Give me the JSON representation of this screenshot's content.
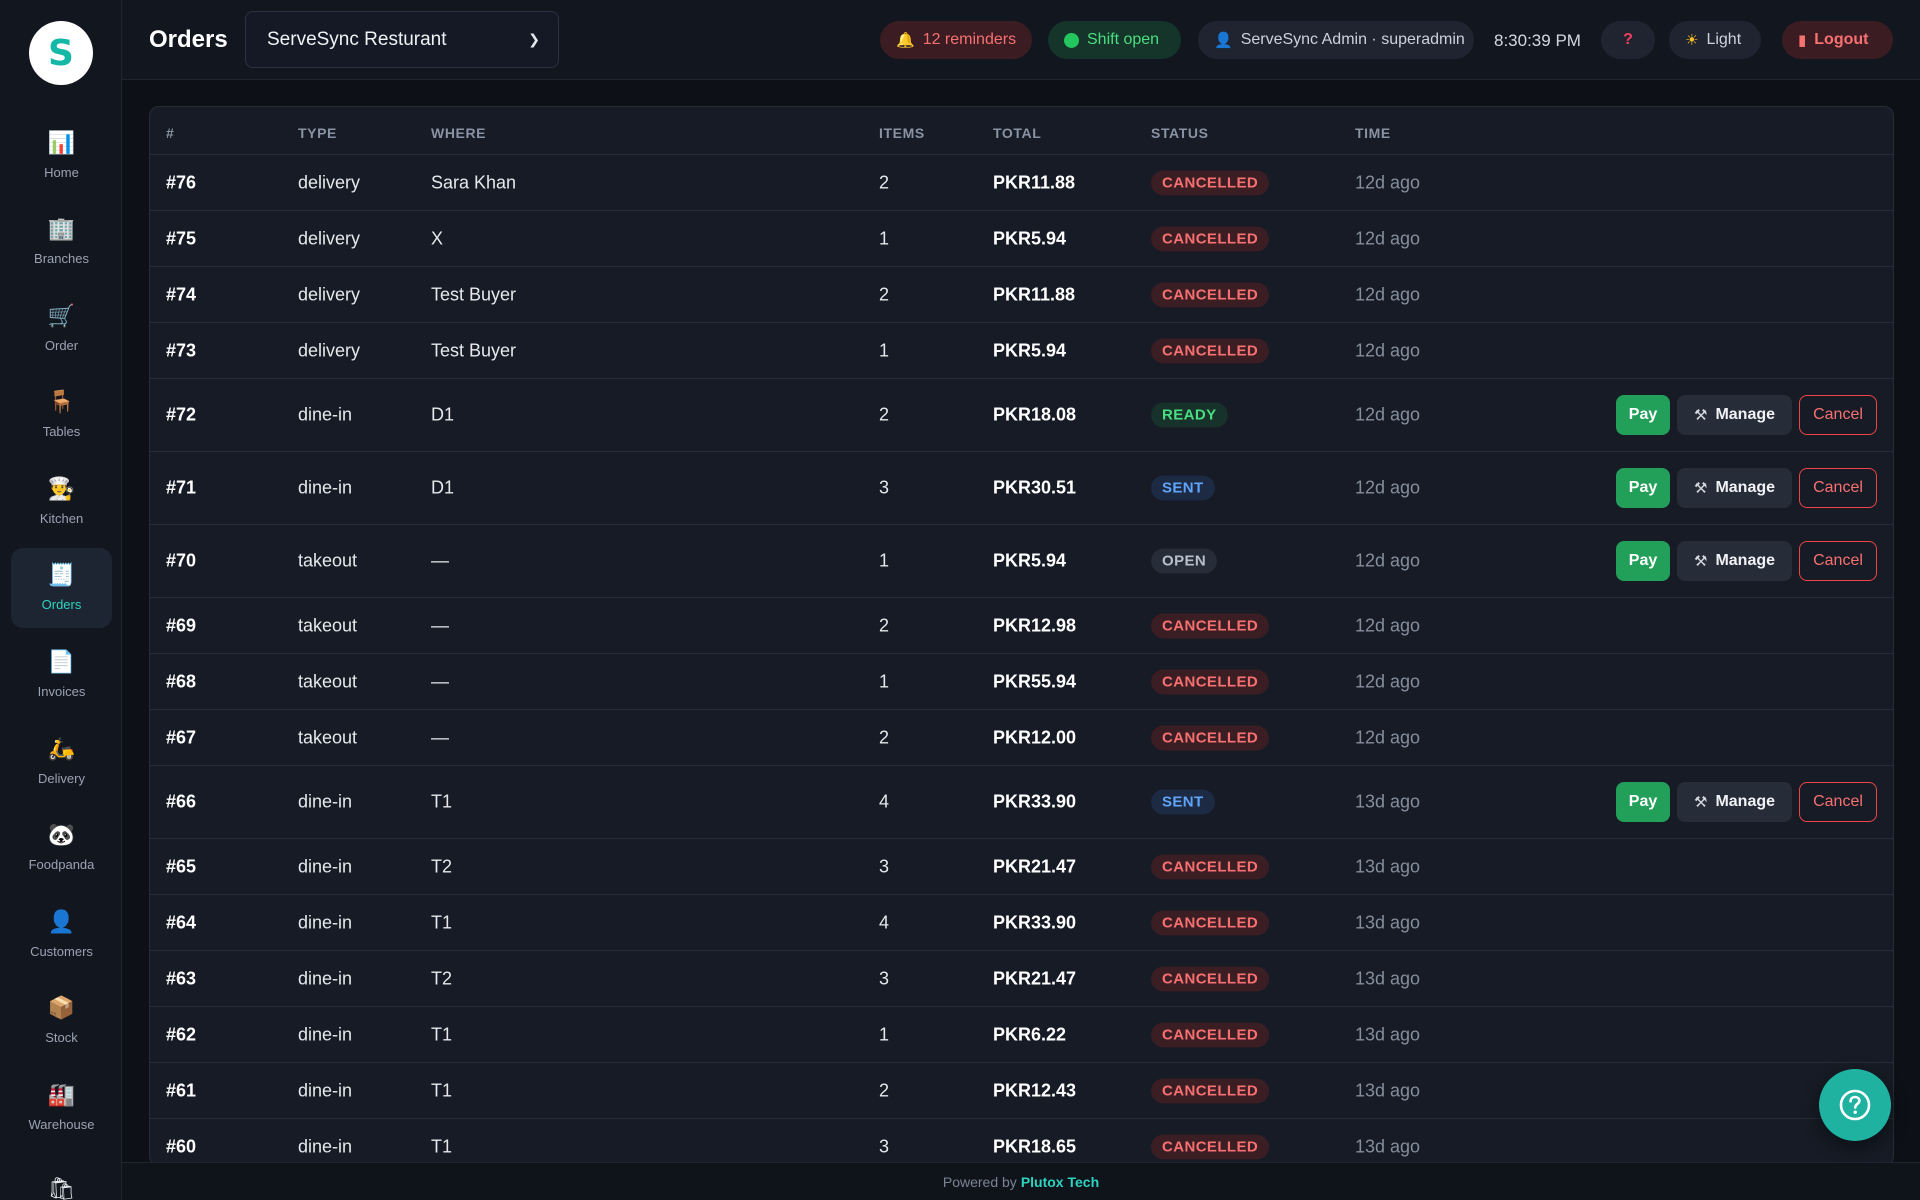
{
  "sidebar": {
    "logo_letter": "S",
    "items": [
      {
        "label": "Home",
        "icon": "chart-icon",
        "glyph": "📊",
        "active": false
      },
      {
        "label": "Branches",
        "icon": "building-icon",
        "glyph": "🏢",
        "active": false
      },
      {
        "label": "Order",
        "icon": "cart-icon",
        "glyph": "🛒",
        "active": false
      },
      {
        "label": "Tables",
        "icon": "chair-icon",
        "glyph": "🪑",
        "active": false
      },
      {
        "label": "Kitchen",
        "icon": "chef-icon",
        "glyph": "👨‍🍳",
        "active": false
      },
      {
        "label": "Orders",
        "icon": "receipt-icon",
        "glyph": "🧾",
        "active": true
      },
      {
        "label": "Invoices",
        "icon": "document-icon",
        "glyph": "📄",
        "active": false
      },
      {
        "label": "Delivery",
        "icon": "scooter-icon",
        "glyph": "🛵",
        "active": false
      },
      {
        "label": "Foodpanda",
        "icon": "panda-icon",
        "glyph": "🐼",
        "active": false
      },
      {
        "label": "Customers",
        "icon": "user-icon",
        "glyph": "👤",
        "active": false
      },
      {
        "label": "Stock",
        "icon": "box-icon",
        "glyph": "📦",
        "active": false
      },
      {
        "label": "Warehouse",
        "icon": "factory-icon",
        "glyph": "🏭",
        "active": false
      },
      {
        "label": "",
        "icon": "bag-icon",
        "glyph": "🛍",
        "active": false
      }
    ]
  },
  "header": {
    "title": "Orders",
    "branch": "ServeSync Resturant",
    "reminders": "12 reminders",
    "shift": "Shift open",
    "user": "ServeSync Admin · superadmin",
    "clock": "8:30:39 PM",
    "help": "?",
    "theme": "Light",
    "logout": "Logout"
  },
  "table": {
    "columns": {
      "id": "#",
      "type": "TYPE",
      "where": "WHERE",
      "items": "ITEMS",
      "total": "TOTAL",
      "status": "STATUS",
      "time": "TIME"
    },
    "actions": {
      "pay": "Pay",
      "manage": "Manage",
      "cancel": "Cancel"
    },
    "rows": [
      {
        "id": "#76",
        "type": "delivery",
        "where": "Sara Khan",
        "items": "2",
        "total": "PKR11.88",
        "status": "CANCELLED",
        "time": "12d ago"
      },
      {
        "id": "#75",
        "type": "delivery",
        "where": "X",
        "items": "1",
        "total": "PKR5.94",
        "status": "CANCELLED",
        "time": "12d ago"
      },
      {
        "id": "#74",
        "type": "delivery",
        "where": "Test Buyer",
        "items": "2",
        "total": "PKR11.88",
        "status": "CANCELLED",
        "time": "12d ago"
      },
      {
        "id": "#73",
        "type": "delivery",
        "where": "Test Buyer",
        "items": "1",
        "total": "PKR5.94",
        "status": "CANCELLED",
        "time": "12d ago"
      },
      {
        "id": "#72",
        "type": "dine-in",
        "where": "D1",
        "items": "2",
        "total": "PKR18.08",
        "status": "READY",
        "time": "12d ago"
      },
      {
        "id": "#71",
        "type": "dine-in",
        "where": "D1",
        "items": "3",
        "total": "PKR30.51",
        "status": "SENT",
        "time": "12d ago"
      },
      {
        "id": "#70",
        "type": "takeout",
        "where": "—",
        "items": "1",
        "total": "PKR5.94",
        "status": "OPEN",
        "time": "12d ago"
      },
      {
        "id": "#69",
        "type": "takeout",
        "where": "—",
        "items": "2",
        "total": "PKR12.98",
        "status": "CANCELLED",
        "time": "12d ago"
      },
      {
        "id": "#68",
        "type": "takeout",
        "where": "—",
        "items": "1",
        "total": "PKR55.94",
        "status": "CANCELLED",
        "time": "12d ago"
      },
      {
        "id": "#67",
        "type": "takeout",
        "where": "—",
        "items": "2",
        "total": "PKR12.00",
        "status": "CANCELLED",
        "time": "12d ago"
      },
      {
        "id": "#66",
        "type": "dine-in",
        "where": "T1",
        "items": "4",
        "total": "PKR33.90",
        "status": "SENT",
        "time": "13d ago"
      },
      {
        "id": "#65",
        "type": "dine-in",
        "where": "T2",
        "items": "3",
        "total": "PKR21.47",
        "status": "CANCELLED",
        "time": "13d ago"
      },
      {
        "id": "#64",
        "type": "dine-in",
        "where": "T1",
        "items": "4",
        "total": "PKR33.90",
        "status": "CANCELLED",
        "time": "13d ago"
      },
      {
        "id": "#63",
        "type": "dine-in",
        "where": "T2",
        "items": "3",
        "total": "PKR21.47",
        "status": "CANCELLED",
        "time": "13d ago"
      },
      {
        "id": "#62",
        "type": "dine-in",
        "where": "T1",
        "items": "1",
        "total": "PKR6.22",
        "status": "CANCELLED",
        "time": "13d ago"
      },
      {
        "id": "#61",
        "type": "dine-in",
        "where": "T1",
        "items": "2",
        "total": "PKR12.43",
        "status": "CANCELLED",
        "time": "13d ago"
      },
      {
        "id": "#60",
        "type": "dine-in",
        "where": "T1",
        "items": "3",
        "total": "PKR18.65",
        "status": "CANCELLED",
        "time": "13d ago"
      }
    ]
  },
  "footer": {
    "prefix": "Powered by",
    "brand": "Plutox Tech"
  },
  "colors": {
    "accent": "#2dd4bf",
    "pay": "#22a05a",
    "cancel": "#ef4444",
    "background": "#0d1016"
  }
}
